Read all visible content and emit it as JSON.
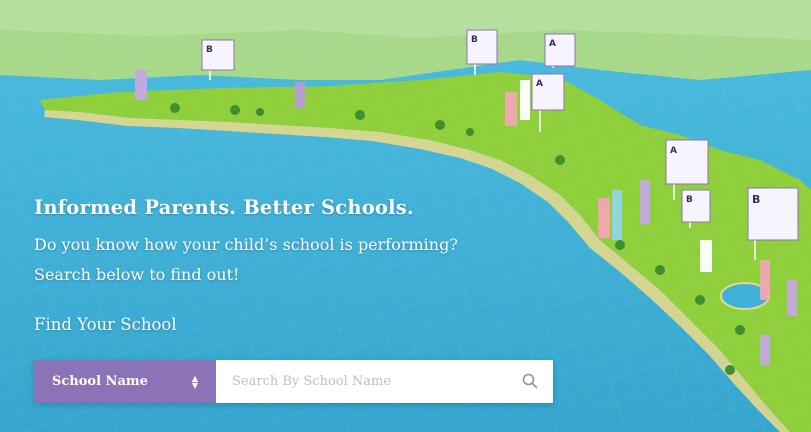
{
  "hero": {
    "headline": "Informed Parents. Better Schools.",
    "subline": "Do you know how your child’s school is performing? Search below to find out!",
    "find_label": "Find Your School",
    "select_label": "School Name",
    "select_icon": "updown-arrows-icon",
    "search_placeholder": "Search By School Name",
    "search_icon": "search-icon",
    "grade_flags": [
      "B",
      "B",
      "A",
      "A",
      "A",
      "B",
      "B"
    ]
  },
  "colors": {
    "ocean": "#3fb0d6",
    "land": "#8fcf3c",
    "background_land": "#a8d98a",
    "select_purple": "#8c72b6",
    "placeholder_gray": "#b9c1cb",
    "text_white": "#ffffff"
  }
}
